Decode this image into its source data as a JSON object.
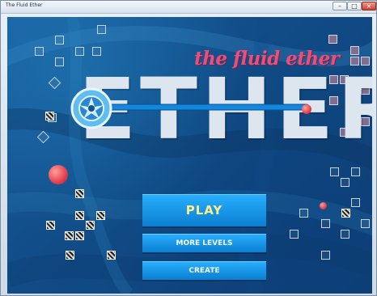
{
  "window": {
    "title": "The Fluid Ether",
    "controls": [
      "min-icon",
      "max-icon",
      "close-icon"
    ]
  },
  "game": {
    "tagline": "the fluid ether",
    "logo": "ETHERS",
    "menu": {
      "play": "PLAY",
      "more_levels": "MORE LEVELS",
      "create": "CREATE"
    }
  },
  "colors": {
    "background": "#1a5fa0",
    "accent": "#e6507d",
    "button": "#0c7ed1",
    "button_text": "#f3fbff",
    "play_text": "#ffef87"
  }
}
